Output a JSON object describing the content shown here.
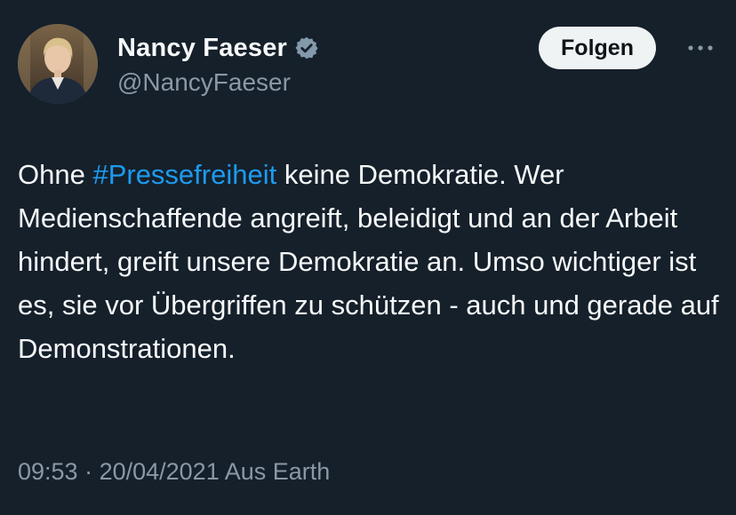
{
  "author": {
    "display_name": "Nancy Faeser",
    "handle": "@NancyFaeser",
    "verified": true
  },
  "actions": {
    "follow_label": "Folgen",
    "more_icon": "more-horizontal-icon"
  },
  "tweet": {
    "text_before": "Ohne  ",
    "hashtag": "#Pressefreiheit",
    "text_after": " keine Demokratie. Wer Medienschaffende angreift, beleidigt und an der Arbeit hindert, greift unsere Demokratie an. Umso wichtiger ist es, sie vor Übergriffen zu schützen - auch und gerade auf Demonstrationen."
  },
  "meta": {
    "time": "09:53",
    "separator": " · ",
    "date": "20/04/2021",
    "location": " Aus Earth"
  },
  "colors": {
    "background": "#15202b",
    "text": "#f7f9f9",
    "secondary": "#8b98a5",
    "link": "#1d9bf0",
    "verified_badge": "#829aab"
  }
}
